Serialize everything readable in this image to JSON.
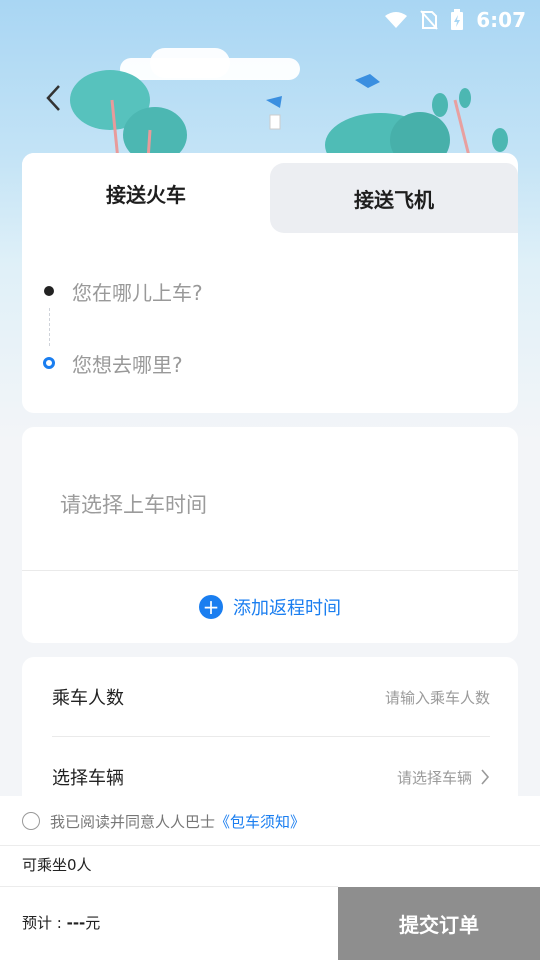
{
  "status_bar": {
    "time": "6:07"
  },
  "tabs": [
    {
      "label": "接送火车",
      "active": true
    },
    {
      "label": "接送飞机",
      "active": false
    }
  ],
  "route": {
    "pickup_placeholder": "您在哪儿上车?",
    "dropoff_placeholder": "您想去哪里?"
  },
  "time_card": {
    "pickup_time_placeholder": "请选择上车时间",
    "add_return_label": "添加返程时间"
  },
  "passenger_card": {
    "count_label": "乘车人数",
    "count_placeholder": "请输入乘车人数",
    "vehicle_label": "选择车辆",
    "vehicle_placeholder": "请选择车辆"
  },
  "agreement": {
    "text": "我已阅读并同意人人巴士",
    "link": "《包车须知》"
  },
  "capacity_text": "可乘坐0人",
  "estimate": {
    "label": "预计 : ",
    "price": "---",
    "unit": "元"
  },
  "submit_label": "提交订单",
  "colors": {
    "accent": "#1a7ef0",
    "submit_disabled": "#8e8e8e",
    "sky": "#a9d6f3"
  }
}
